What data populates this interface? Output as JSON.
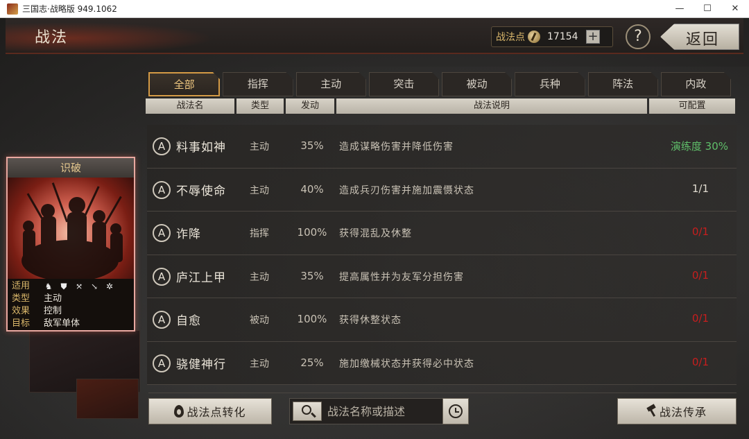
{
  "window": {
    "title": "三国志·战略版 949.1062",
    "minimize": "—",
    "maximize": "☐",
    "close": "✕"
  },
  "header": {
    "title": "战法",
    "points_label": "战法点",
    "points_value": "17154",
    "plus": "+",
    "help": "?",
    "back": "返回"
  },
  "tabs": [
    {
      "label": "全部",
      "active": true
    },
    {
      "label": "指挥"
    },
    {
      "label": "主动"
    },
    {
      "label": "突击"
    },
    {
      "label": "被动"
    },
    {
      "label": "兵种"
    },
    {
      "label": "阵法"
    },
    {
      "label": "内政"
    }
  ],
  "columns": {
    "name": "战法名",
    "type": "类型",
    "rate": "发动",
    "desc": "战法说明",
    "config": "可配置"
  },
  "tactics": [
    {
      "grade": "A",
      "name": "料事如神",
      "type": "主动",
      "rate": "35%",
      "desc": "造成谋略伤害并降低伤害",
      "config": "演练度 30%",
      "config_color": "#5fbf6a"
    },
    {
      "grade": "A",
      "name": "不辱使命",
      "type": "主动",
      "rate": "40%",
      "desc": "造成兵刃伤害并施加震慑状态",
      "config": "1/1",
      "config_color": "#e0dbd0"
    },
    {
      "grade": "A",
      "name": "诈降",
      "type": "指挥",
      "rate": "100%",
      "desc": "获得混乱及休整",
      "config": "0/1",
      "config_color": "#c81e1e"
    },
    {
      "grade": "A",
      "name": "庐江上甲",
      "type": "主动",
      "rate": "35%",
      "desc": "提高属性并为友军分担伤害",
      "config": "0/1",
      "config_color": "#c81e1e"
    },
    {
      "grade": "A",
      "name": "自愈",
      "type": "被动",
      "rate": "100%",
      "desc": "获得休整状态",
      "config": "0/1",
      "config_color": "#c81e1e"
    },
    {
      "grade": "A",
      "name": "骁健神行",
      "type": "主动",
      "rate": "25%",
      "desc": "施加缴械状态并获得必中状态",
      "config": "0/1",
      "config_color": "#c81e1e"
    }
  ],
  "card": {
    "title": "识破",
    "apply_label": "适用",
    "apply_units": [
      "cavalry-icon",
      "shield-icon",
      "bow-icon",
      "spear-icon",
      "wheel-icon"
    ],
    "type_label": "类型",
    "type_value": "主动",
    "effect_label": "效果",
    "effect_value": "控制",
    "target_label": "目标",
    "target_value": "敌军单体"
  },
  "bottom": {
    "convert": "战法点转化",
    "search_placeholder": "战法名称或描述",
    "inherit": "战法传承"
  }
}
